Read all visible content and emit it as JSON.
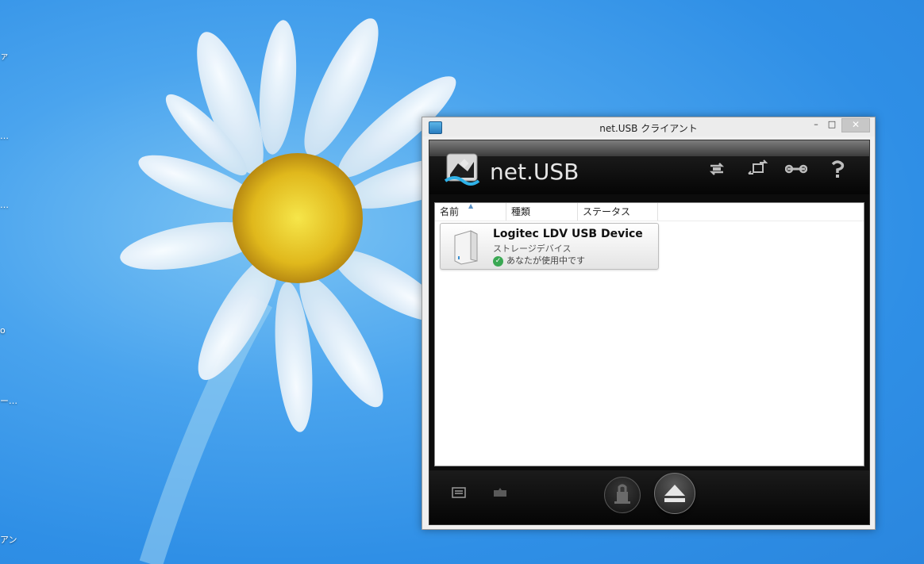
{
  "desktop": {
    "fragments": [
      "ァ",
      "…",
      "…",
      "о",
      "ー…",
      "アン"
    ]
  },
  "window": {
    "title": "net.USB クライアント",
    "controls": {
      "minimize": "–",
      "maximize": "□",
      "close": "✕"
    }
  },
  "app": {
    "logo_text": "net.USB",
    "toolbar_icons": [
      "refresh-icon",
      "switch-icon",
      "settings-wrench-icon",
      "help-icon"
    ],
    "columns": [
      "名前",
      "種類",
      "ステータス"
    ],
    "devices": [
      {
        "name": "Logitec LDV USB Device",
        "type": "ストレージデバイス",
        "status": "あなたが使用中です"
      }
    ],
    "bottom_icons": [
      "view-list-icon",
      "message-icon"
    ],
    "bottom_buttons": [
      "connect-button",
      "eject-button"
    ]
  }
}
